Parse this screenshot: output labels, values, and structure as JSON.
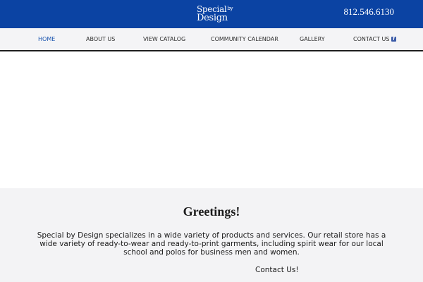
{
  "header": {
    "logo_line1": "Special",
    "logo_by": "by",
    "logo_line2": "Design",
    "phone": "812.546.6130",
    "background_color": "#0b43a3"
  },
  "nav": {
    "items": [
      {
        "label": "HOME",
        "active": true
      },
      {
        "label": "ABOUT US"
      },
      {
        "label": "VIEW CATALOG"
      },
      {
        "label": "COMMUNITY CALENDAR"
      },
      {
        "label": "GALLERY"
      },
      {
        "label": "CONTACT US"
      }
    ],
    "social_icon": "facebook-icon",
    "active_color": "#1d56b0"
  },
  "main": {
    "heading": "Greetings!",
    "description": "Special by Design specializes in a wide variety of products and services. Our retail store has a wide variety of ready-to-wear and ready-to-print garments, including spirit wear for our local school and polos for business men and women.",
    "contact_link": "Contact Us!"
  }
}
